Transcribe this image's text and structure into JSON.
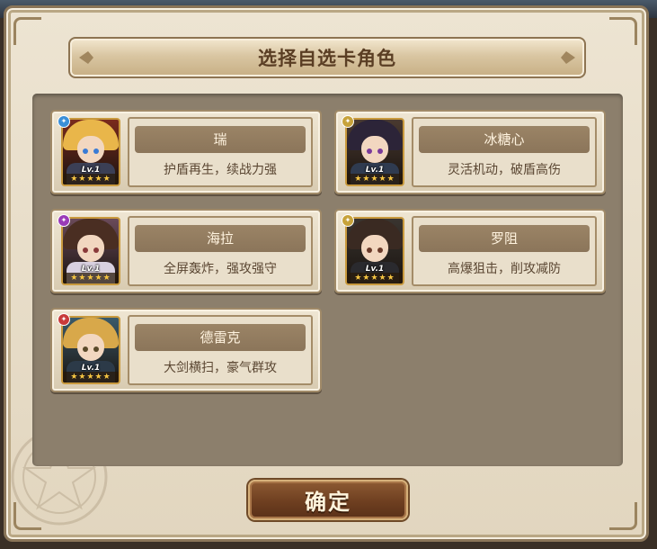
{
  "dialog": {
    "title": "选择自选卡角色",
    "confirm_label": "确定"
  },
  "characters": [
    {
      "name": "瑞",
      "desc": "护盾再生，续战力强",
      "level": "Lv.1",
      "stars": "★★★★★",
      "badge_color": "#3a8fd8",
      "hair_color": "#e9b64a",
      "body_color": "#3b3f55",
      "eye_color": "#3a7bd5",
      "bg_color": "#7a2a1c"
    },
    {
      "name": "冰糖心",
      "desc": "灵活机动，破盾高伤",
      "level": "Lv.1",
      "stars": "★★★★★",
      "badge_color": "#c7a23a",
      "hair_color": "#2c2438",
      "body_color": "#2f3b50",
      "eye_color": "#7a3a9a",
      "bg_color": "#4a3a30"
    },
    {
      "name": "海拉",
      "desc": "全屏轰炸，强攻强守",
      "level": "Lv.1",
      "stars": "★★★★★",
      "badge_color": "#9a3ab8",
      "hair_color": "#4a2e22",
      "body_color": "#d8d0e0",
      "eye_color": "#8a3a3a",
      "bg_color": "#6a4a5a"
    },
    {
      "name": "罗阻",
      "desc": "高爆狙击，削攻减防",
      "level": "Lv.1",
      "stars": "★★★★★",
      "badge_color": "#c7a23a",
      "hair_color": "#3a2a22",
      "body_color": "#2a2a2e",
      "eye_color": "#6a3a2a",
      "bg_color": "#3a3530"
    },
    {
      "name": "德雷克",
      "desc": "大剑横扫，豪气群攻",
      "level": "Lv.1",
      "stars": "★★★★★",
      "badge_color": "#c83a3a",
      "hair_color": "#d8a84a",
      "body_color": "#2c3a48",
      "eye_color": "#5a4a2a",
      "bg_color": "#3a5a6a"
    }
  ]
}
